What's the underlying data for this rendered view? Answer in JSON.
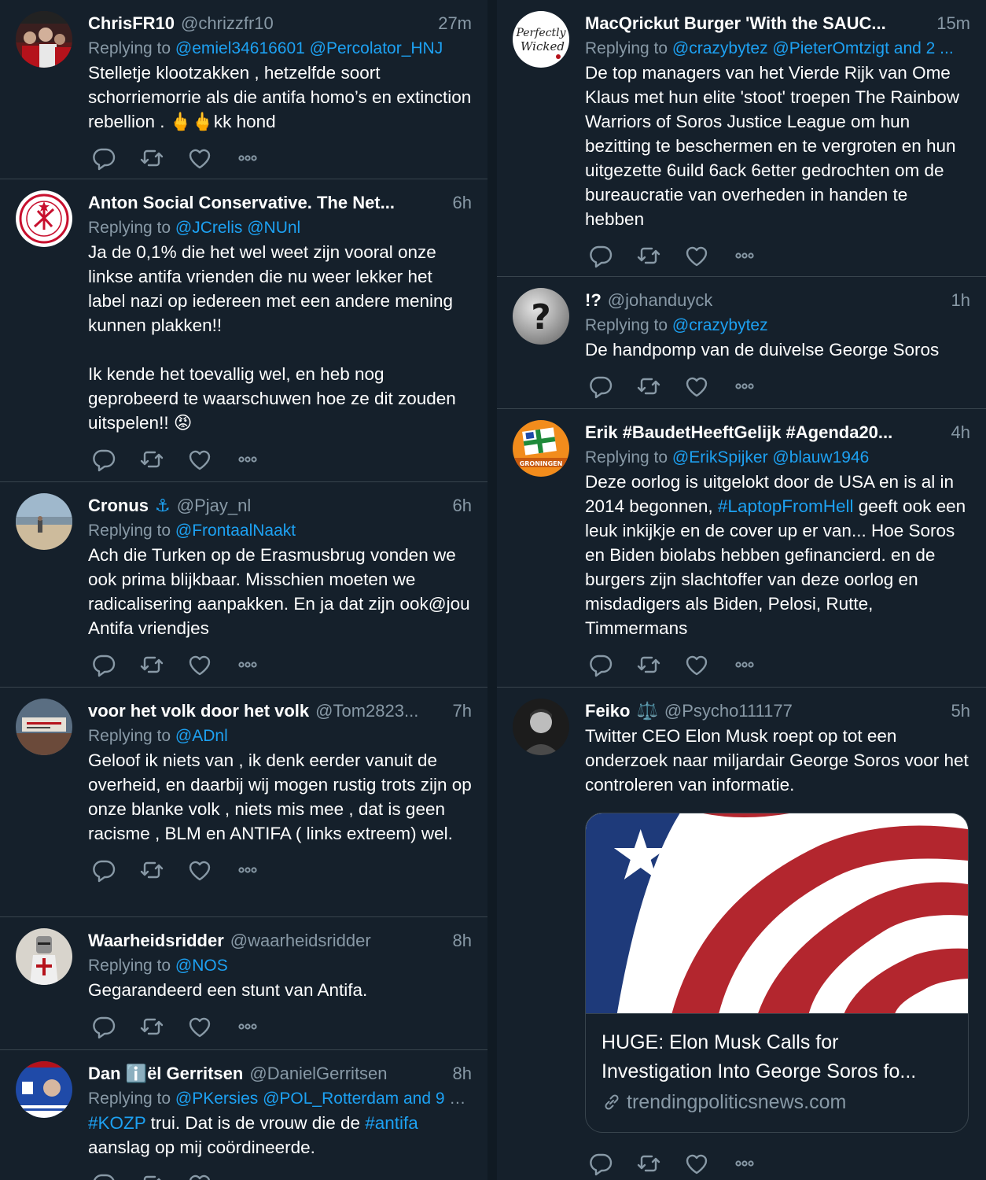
{
  "left": [
    {
      "name": "ChrisFR10",
      "handle": "@chrizzfr10",
      "time": "27m",
      "reply_prefix": "Replying to ",
      "mentions": "@emiel34616601 @Percolator_HNJ",
      "text": "Stelletje klootzakken , hetzelfde soort schorriemorrie als die antifa homo’s en extinction rebellion . 🖕🖕kk hond",
      "avatar_icon": "crowd-photo-avatar"
    },
    {
      "name": "Anton Social Conservative. The Net...",
      "handle": "",
      "time": "6h",
      "reply_prefix": "Replying to ",
      "mentions": "@JCrelis @NUnl",
      "text": "Ja de 0,1% die het wel weet zijn vooral onze linkse antifa vrienden die nu weer lekker het label nazi op iedereen met een andere mening kunnen plakken!!\n\nIk kende het toevallig wel, en heb nog geprobeerd te waarschuwen hoe ze dit zouden uitspelen!! 😡",
      "avatar_icon": "red-emblem-avatar"
    },
    {
      "name": "Cronus",
      "name_badge": "⚓",
      "handle": "@Pjay_nl",
      "time": "6h",
      "reply_prefix": "Replying to ",
      "mentions": "@FrontaalNaakt",
      "text": "Ach die Turken op de Erasmusbrug vonden we ook prima blijkbaar. Misschien moeten we radicalisering aanpakken. En ja dat zijn ook@jou Antifa vriendjes",
      "avatar_icon": "beach-photo-avatar"
    },
    {
      "name": "voor het volk door het volk",
      "handle": "@Tom2823...",
      "time": "7h",
      "reply_prefix": "Replying to ",
      "mentions": "@ADnl",
      "text": "Geloof ik niets van , ik denk eerder vanuit de overheid,  en daarbij wij mogen rustig trots zijn op onze blanke volk , niets mis mee , dat is geen racisme , BLM en ANTIFA ( links extreem) wel.",
      "avatar_icon": "banner-photo-avatar"
    },
    {
      "name": "Waarheidsridder",
      "handle": "@waarheidsridder",
      "time": "8h",
      "reply_prefix": "Replying to ",
      "mentions": "@NOS",
      "text": "Gegarandeerd een stunt van Antifa.",
      "avatar_icon": "knight-avatar"
    },
    {
      "name": "Dan ℹ️ël Gerritsen",
      "handle": "@DanielGerritsen",
      "time": "8h",
      "reply_prefix": "Replying to ",
      "mentions": "@PKersies @POL_Rotterdam and 9 o...",
      "text_link1": "#KOZP",
      "text_mid": " trui. Dat is de vrouw die de ",
      "text_link2": "#antifa",
      "text_end": "\naanslag op mij coördineerde.",
      "avatar_icon": "israel-flag-avatar"
    }
  ],
  "right": [
    {
      "name": "MacQrickut Burger 'With the SAUC...",
      "handle": "",
      "time": "15m",
      "reply_prefix": "Replying to ",
      "mentions": "@crazybytez @PieterOmtzigt and 2 ...",
      "text": "De top managers van het Vierde Rijk van Ome Klaus met hun elite 'stoot' troepen The Rainbow Warriors of Soros  Justice League om hun bezitting te beschermen en te vergroten en hun uitgezette 6uild 6ack 6etter gedrochten om de bureaucratie van overheden in handen te hebben",
      "avatar_icon": "perfectly-wicked-avatar"
    },
    {
      "name": "!?",
      "handle": "@johanduyck",
      "time": "1h",
      "reply_prefix": "Replying to ",
      "mentions": "@crazybytez",
      "text": "De handpomp van de duivelse George Soros",
      "avatar_icon": "question-mark-avatar"
    },
    {
      "name": "Erik #BaudetHeeftGelijk #Agenda20...",
      "handle": "",
      "time": "4h",
      "reply_prefix": "Replying to ",
      "mentions": "@ErikSpijker @blauw1946",
      "text_start": "Deze oorlog is uitgelokt door de USA en is al in 2014 begonnen, ",
      "text_link": "#LaptopFromHell",
      "text_end": " geeft ook een leuk inkijkje en de cover up er van... Hoe Soros en Biden biolabs hebben gefinancierd. en de burgers zijn slachtoffer van deze oorlog en misdadigers als Biden, Pelosi, Rutte, Timmermans",
      "avatar_icon": "groningen-flag-avatar",
      "avatar_label": "GRONINGEN"
    },
    {
      "name": "Feiko",
      "name_badge": "⚖️",
      "handle": "@Psycho111177",
      "time": "5h",
      "text": "Twitter CEO Elon Musk roept op tot een onderzoek naar miljardair George Soros voor het controleren van informatie.",
      "avatar_icon": "portrait-photo-avatar",
      "card": {
        "title": "HUGE: Elon Musk Calls for Investigation Into George Soros fo...",
        "domain": "trendingpoliticsnews.com",
        "image_icon": "us-flag-stripes-image"
      }
    }
  ],
  "actions": {
    "reply": "reply-icon",
    "retweet": "retweet-icon",
    "like": "like-icon",
    "more": "more-icon"
  },
  "colors": {
    "background": "#15202b",
    "border": "#38444d",
    "muted": "#8899a6",
    "link": "#1da1f2"
  },
  "perfectly_wicked_text": "Perfectly Wicked"
}
